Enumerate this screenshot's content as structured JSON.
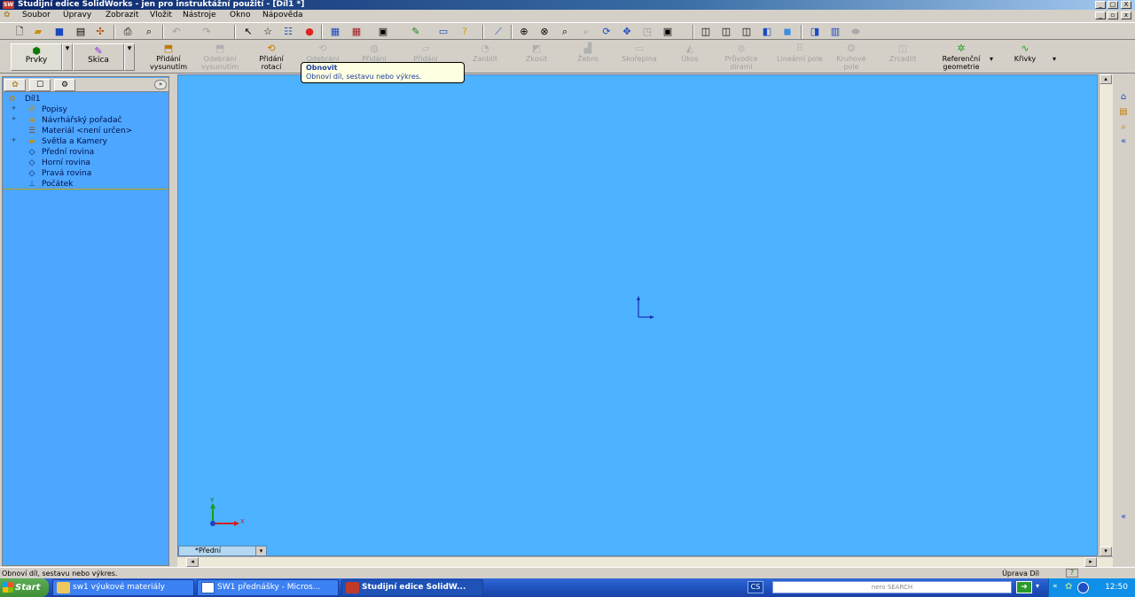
{
  "window": {
    "title": "Studijní edice SolidWorks - jen pro instruktážní použití - [Díl1 *]",
    "minimize": "_",
    "maximize": "□",
    "close": "X"
  },
  "menu": [
    "Soubor",
    "Úpravy",
    "Zobrazit",
    "Vložit",
    "Nástroje",
    "Okno",
    "Nápověda"
  ],
  "command_manager": {
    "tabs": [
      {
        "label": "Prvky",
        "icon": "features-icon"
      },
      {
        "label": "Skica",
        "icon": "sketch-icon"
      }
    ],
    "commands": [
      {
        "label": "Přidání vysunutím",
        "enabled": true
      },
      {
        "label": "Odebrání vysunutím",
        "enabled": false
      },
      {
        "label": "Přidání rotací",
        "enabled": true
      },
      {
        "label": "Odebrání",
        "enabled": false
      },
      {
        "label": "Přidání",
        "enabled": false
      },
      {
        "label": "Přidání",
        "enabled": false
      },
      {
        "label": "Zaoblit",
        "enabled": false
      },
      {
        "label": "Zkosit",
        "enabled": false
      },
      {
        "label": "Žebro",
        "enabled": false
      },
      {
        "label": "Skořepina",
        "enabled": false
      },
      {
        "label": "Úkos",
        "enabled": false
      },
      {
        "label": "Průvodce dírami",
        "enabled": false
      },
      {
        "label": "Lineární pole",
        "enabled": false
      },
      {
        "label": "Kruhové pole",
        "enabled": false
      },
      {
        "label": "Zrcadlit",
        "enabled": false
      },
      {
        "label": "Referenční geometrie",
        "enabled": true
      },
      {
        "label": "Křivky",
        "enabled": true
      }
    ]
  },
  "tooltip": {
    "title": "Obnovit",
    "text": "Obnoví díl, sestavu nebo výkres."
  },
  "feature_tree": {
    "root": "Díl1",
    "items": [
      {
        "label": "Popisy",
        "icon": "annotations-icon",
        "expandable": true
      },
      {
        "label": "Návrhářský pořadač",
        "icon": "design-binder-icon",
        "expandable": true
      },
      {
        "label": "Materiál <není určen>",
        "icon": "material-icon",
        "expandable": false
      },
      {
        "label": "Světla a Kamery",
        "icon": "lights-icon",
        "expandable": true
      },
      {
        "label": "Přední rovina",
        "icon": "plane-icon",
        "expandable": false
      },
      {
        "label": "Horní rovina",
        "icon": "plane-icon",
        "expandable": false
      },
      {
        "label": "Pravá rovina",
        "icon": "plane-icon",
        "expandable": false
      },
      {
        "label": "Počátek",
        "icon": "origin-icon",
        "expandable": false
      }
    ]
  },
  "viewport": {
    "view_tab": "*Přední",
    "triad": {
      "x": "X",
      "y": "Y"
    },
    "background": "#4db2ff"
  },
  "status_bar": {
    "text": "Obnoví díl, sestavu nebo výkres.",
    "mode": "Úprava Díl"
  },
  "taskbar": {
    "start": "Start",
    "items": [
      {
        "label": "sw1 výukové materiály",
        "active": false
      },
      {
        "label": "SW1 přednášky - Micros...",
        "active": false
      },
      {
        "label": "Studijní edice SolidW...",
        "active": true
      }
    ],
    "language": "CS",
    "search_placeholder": "nero SEARCH",
    "clock": "12:50"
  }
}
